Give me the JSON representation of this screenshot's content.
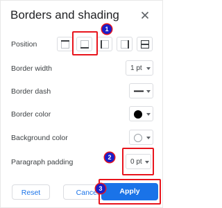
{
  "dialog": {
    "title": "Borders and shading",
    "close_icon": "close-icon"
  },
  "rows": {
    "position": {
      "label": "Position"
    },
    "border_width": {
      "label": "Border width",
      "value": "1 pt"
    },
    "border_dash": {
      "label": "Border dash"
    },
    "border_color": {
      "label": "Border color",
      "swatch_color": "#000000"
    },
    "background_color": {
      "label": "Background color",
      "swatch_color": "#ffffff"
    },
    "paragraph_padding": {
      "label": "Paragraph padding",
      "value": "0 pt"
    }
  },
  "position_options": [
    {
      "icon": "border-top-icon"
    },
    {
      "icon": "border-bottom-icon",
      "selected": true
    },
    {
      "icon": "border-left-icon"
    },
    {
      "icon": "border-right-icon"
    },
    {
      "icon": "border-between-icon"
    }
  ],
  "footer": {
    "reset_label": "Reset",
    "cancel_label": "Cancel",
    "apply_label": "Apply"
  },
  "annotations": [
    {
      "number": "1"
    },
    {
      "number": "2"
    },
    {
      "number": "3"
    }
  ],
  "colors": {
    "accent": "#1a73e8",
    "highlight": "#e8141c",
    "badge": "#1a1ec8"
  }
}
